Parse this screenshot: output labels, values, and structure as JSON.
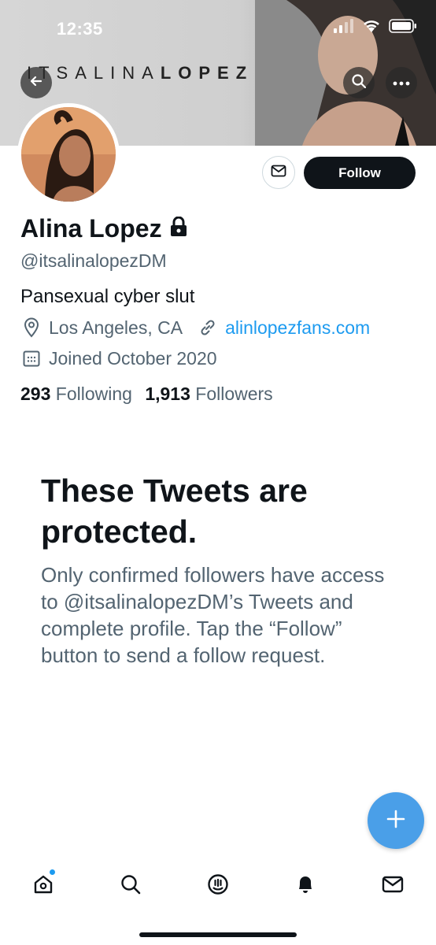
{
  "status_bar": {
    "time": "12:35"
  },
  "banner": {
    "brand_light": "ITSALINA",
    "brand_bold": "LOPEZ"
  },
  "profile": {
    "name": "Alina Lopez",
    "handle": "@itsalinalopezDM",
    "bio": "Pansexual cyber slut",
    "location": "Los Angeles, CA",
    "website": "alinlopezfans.com",
    "joined": "Joined October 2020",
    "following_count": "293",
    "following_label": "Following",
    "followers_count": "1,913",
    "followers_label": "Followers"
  },
  "actions": {
    "follow_label": "Follow"
  },
  "protected": {
    "title": "These Tweets are protected.",
    "body": "Only confirmed followers have access to @itsalinalopezDM’s Tweets and complete profile. Tap the “Follow” button to send a follow request."
  },
  "tabs": [
    {
      "icon": "home-icon"
    },
    {
      "icon": "search-icon"
    },
    {
      "icon": "spaces-icon"
    },
    {
      "icon": "notifications-icon"
    },
    {
      "icon": "messages-icon"
    }
  ],
  "colors": {
    "accent": "#1d9bf0",
    "fab": "#4a9fe8",
    "text": "#0f1419",
    "secondary": "#536471"
  }
}
